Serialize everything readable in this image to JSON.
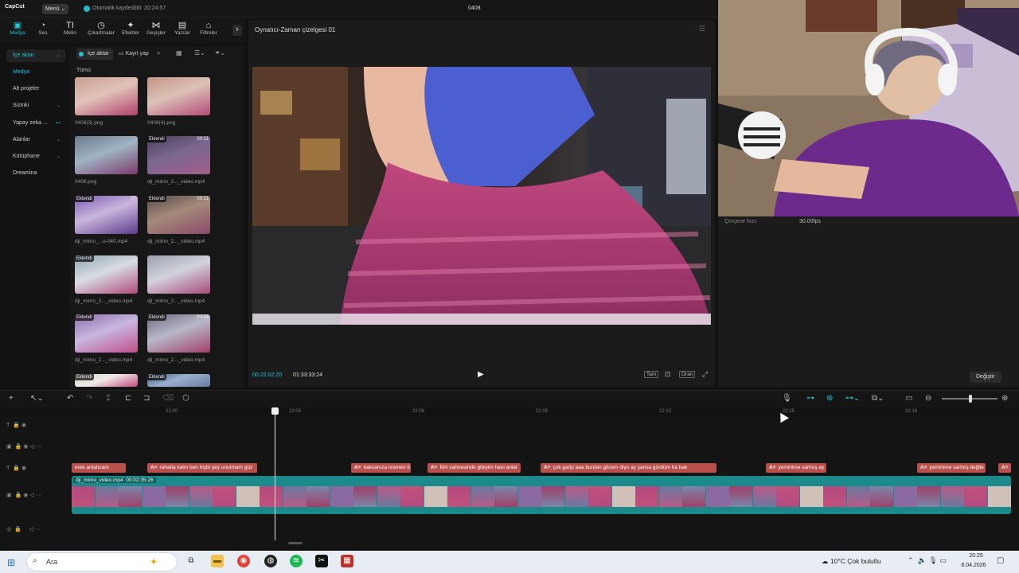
{
  "titlebar": {
    "logo": "CapCut",
    "menu_label": "Menü ⌄",
    "autosave": "Otomatik kaydedildi: 20:24:57",
    "project": "0408"
  },
  "tool_tabs": [
    {
      "label": "Medya",
      "icon": "media-icon",
      "glyph": "▣"
    },
    {
      "label": "Ses",
      "icon": "audio-icon",
      "glyph": "◔"
    },
    {
      "label": "Metin",
      "icon": "text-icon",
      "glyph": "TI"
    },
    {
      "label": "Çıkartmalar",
      "icon": "sticker-icon",
      "glyph": "◷"
    },
    {
      "label": "Efektler",
      "icon": "effects-icon",
      "glyph": "✦"
    },
    {
      "label": "Geçişler",
      "icon": "transition-icon",
      "glyph": "⋈"
    },
    {
      "label": "Yazılar",
      "icon": "captions-icon",
      "glyph": "▤"
    },
    {
      "label": "Filtreler",
      "icon": "filter-icon",
      "glyph": "⌂"
    }
  ],
  "media_nav": [
    {
      "label": "İçe aktar",
      "arrow": "⌄"
    },
    {
      "label": "Medya",
      "arrow": ""
    },
    {
      "label": "Alt projeler",
      "arrow": ""
    },
    {
      "label": "Sizinki",
      "arrow": "⌄"
    },
    {
      "label": "Yapay zeka ...",
      "arrow": "⊷"
    },
    {
      "label": "Alanlar",
      "arrow": "⌄"
    },
    {
      "label": "Kütüphane",
      "arrow": "⌄"
    },
    {
      "label": "Dreamina",
      "arrow": ""
    }
  ],
  "media_panel": {
    "import_label": "İçe aktar",
    "record_label": "Kayıt yap",
    "all_label": "Tümü",
    "items": [
      {
        "name": "0408(3).png",
        "badge": "",
        "duration": ""
      },
      {
        "name": "0408(4).png",
        "badge": "",
        "duration": ""
      },
      {
        "name": "0408.png",
        "badge": "",
        "duration": ""
      },
      {
        "name": "dji_mimo_2..._video.mp4",
        "badge": "Eklendi",
        "duration": "00:11"
      },
      {
        "name": "dji_mimo_...o-040.mp4",
        "badge": "Eklendi",
        "duration": "07"
      },
      {
        "name": "dji_mimo_2..._video.mp4",
        "badge": "Eklendi",
        "duration": "00:11"
      },
      {
        "name": "dji_mimo_2..._video.mp4",
        "badge": "Eklendi",
        "duration": ""
      },
      {
        "name": "dji_mimo_2..._video.mp4",
        "badge": "",
        "duration": ""
      },
      {
        "name": "dji_mimo_2..._video.mp4",
        "badge": "Eklendi",
        "duration": ""
      },
      {
        "name": "dji_mimo_2..._video.mp4",
        "badge": "Eklendi",
        "duration": "00:44"
      },
      {
        "name": "",
        "badge": "Eklendi",
        "duration": ""
      },
      {
        "name": "",
        "badge": "Eklendi",
        "duration": ""
      }
    ]
  },
  "player": {
    "title": "Oynatıcı-Zaman çizelgesi 01",
    "timecode_current": "00:22:02:20",
    "timecode_total": "01:33:33:24",
    "full_label": "Tam",
    "ratio_label": "Oran"
  },
  "details": {
    "fps_label": "Çerçeve hızı:",
    "fps_value": "30.00fps",
    "change_label": "Değiştir"
  },
  "ruler": [
    "22:00",
    "22:03",
    "22:06",
    "22:09",
    "22:12",
    "22:15",
    "22:18"
  ],
  "captions": [
    {
      "text": "erek anlatıcam",
      "at": ""
    },
    {
      "text": "rahatta kalın ben hiçbi şey unutmam güz",
      "at": "A≡"
    },
    {
      "text": "bakcanıza resmen b",
      "at": "A≡"
    },
    {
      "text": "film sahnesinde gibiyim hani anlat",
      "at": "A≡"
    },
    {
      "text": "çok garip aaa burdan gitcem diyo ay şansa gördüm ha bak",
      "at": "A≡"
    },
    {
      "text": "yeminime sarhoş ay",
      "at": "A≡"
    },
    {
      "text": "yeminime sarhoş değile",
      "at": "A≡"
    },
    {
      "text": "",
      "at": "A≡"
    }
  ],
  "main_clip": {
    "label": "dji_mimo_video.mp4",
    "duration": "00:02:35:26"
  },
  "taskbar": {
    "search_placeholder": "Ara",
    "weather": "10°C  Çok bulutlu",
    "time": "20:25",
    "date": "8.04.2026"
  },
  "colors": {
    "accent": "#23c4d4",
    "caption": "#b8504c",
    "clip": "#1c8a8a"
  }
}
